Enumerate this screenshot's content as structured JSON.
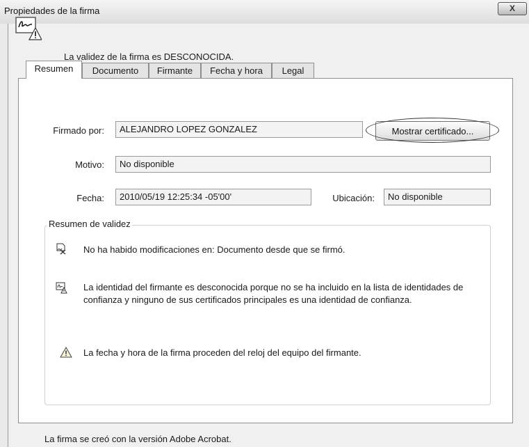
{
  "window": {
    "title": "Propiedades de la firma",
    "close_label": "X"
  },
  "status": {
    "text": "La validez de la firma es DESCONOCIDA.",
    "icon": "signature-unknown-icon"
  },
  "tabs": [
    {
      "label": "Resumen",
      "active": true
    },
    {
      "label": "Documento"
    },
    {
      "label": "Firmante"
    },
    {
      "label": "Fecha y hora"
    },
    {
      "label": "Legal"
    }
  ],
  "summary": {
    "signed_by_label": "Firmado por:",
    "signed_by_value": "ALEJANDRO LOPEZ GONZALEZ",
    "show_cert_label": "Mostrar certificado...",
    "reason_label": "Motivo:",
    "reason_value": "No disponible",
    "date_label": "Fecha:",
    "date_value": "2010/05/19 12:25:34 -05'00'",
    "location_label": "Ubicación:",
    "location_value": "No disponible"
  },
  "validity": {
    "title": "Resumen de validez",
    "items": [
      {
        "icon": "document-unmodified-icon",
        "text": "No ha habido modificaciones en: Documento desde que se firmó."
      },
      {
        "icon": "signer-unknown-icon",
        "text": "La identidad del firmante es desconocida porque no se ha incluido en la lista de identidades de confianza y ninguno de sus certificados principales es una identidad de confianza."
      },
      {
        "icon": "warning-icon",
        "text": "La fecha y hora de la firma proceden del reloj del equipo del firmante."
      }
    ]
  },
  "footer": {
    "text": "La firma se creó con la versión Adobe Acrobat."
  }
}
